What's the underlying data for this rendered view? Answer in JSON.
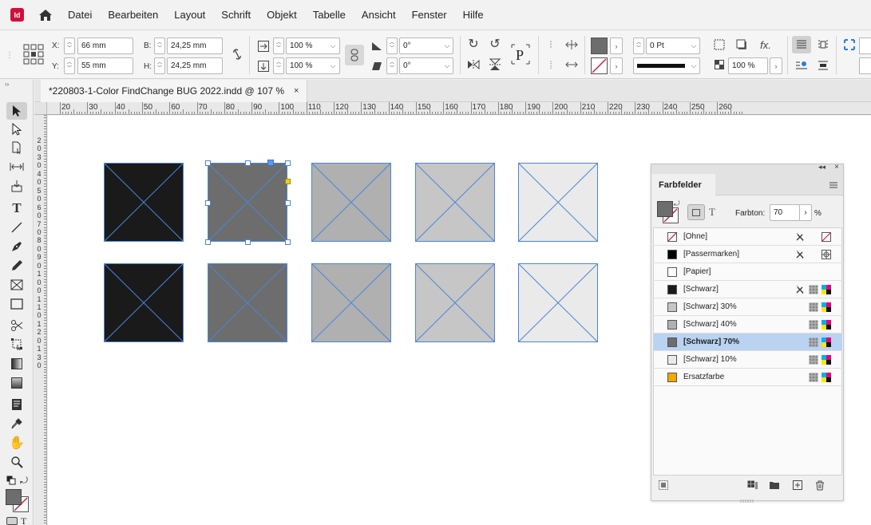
{
  "app": {
    "logo_text": "Id"
  },
  "menu": [
    "Datei",
    "Bearbeiten",
    "Layout",
    "Schrift",
    "Objekt",
    "Tabelle",
    "Ansicht",
    "Fenster",
    "Hilfe"
  ],
  "control": {
    "x_label": "X:",
    "x_value": "66 mm",
    "y_label": "Y:",
    "y_value": "55 mm",
    "w_label": "B:",
    "w_value": "24,25 mm",
    "h_label": "H:",
    "h_value": "24,25 mm",
    "scale_x": "100 %",
    "scale_y": "100 %",
    "rotate": "0°",
    "shear": "0°",
    "stroke_weight": "0 Pt",
    "opacity": "100 %",
    "fill_color": "#6d6d6d"
  },
  "document": {
    "tab_title": "*220803-1-Color FindChange BUG 2022.indd @ 107 %",
    "close_glyph": "×"
  },
  "ruler": {
    "h_labels": [
      "20",
      "30",
      "40",
      "50",
      "60",
      "70",
      "80",
      "90",
      "100",
      "110",
      "120",
      "130",
      "140",
      "150",
      "160",
      "170",
      "180",
      "190",
      "200",
      "210",
      "220",
      "230",
      "240",
      "250",
      "260"
    ],
    "v_labels": [
      "2",
      "0",
      "3",
      "0",
      "4",
      "0",
      "5",
      "0",
      "6",
      "0",
      "7",
      "0",
      "8",
      "0",
      "9",
      "0",
      "1",
      "0",
      "0",
      "1",
      "1",
      "0",
      "1",
      "2",
      "0",
      "1",
      "3",
      "0"
    ]
  },
  "frames": {
    "row1_colors": [
      "#1a1a1a",
      "#6d6d6d",
      "#b0b0b0",
      "#c6c6c6",
      "#eaeaea"
    ],
    "row2_colors": [
      "#1a1a1a",
      "#6d6d6d",
      "#b0b0b0",
      "#c6c6c6",
      "#eaeaea"
    ],
    "selected_index": 1
  },
  "swatches": {
    "panel_title": "Farbfelder",
    "tint_label": "Farbton:",
    "tint_value": "70",
    "tint_unit": "%",
    "items": [
      {
        "name": "[Ohne]",
        "color": "none"
      },
      {
        "name": "[Passermarken]",
        "color": "#000000"
      },
      {
        "name": "[Papier]",
        "color": "#ffffff"
      },
      {
        "name": "[Schwarz]",
        "color": "#1a1a1a"
      },
      {
        "name": "[Schwarz] 30%",
        "color": "#c6c6c6"
      },
      {
        "name": "[Schwarz] 40%",
        "color": "#b0b0b0"
      },
      {
        "name": "[Schwarz] 70%",
        "color": "#6d6d6d"
      },
      {
        "name": "[Schwarz] 10%",
        "color": "#eaeaea"
      },
      {
        "name": "Ersatzfarbe",
        "color": "#f5a800"
      }
    ],
    "selected_index": 6
  }
}
